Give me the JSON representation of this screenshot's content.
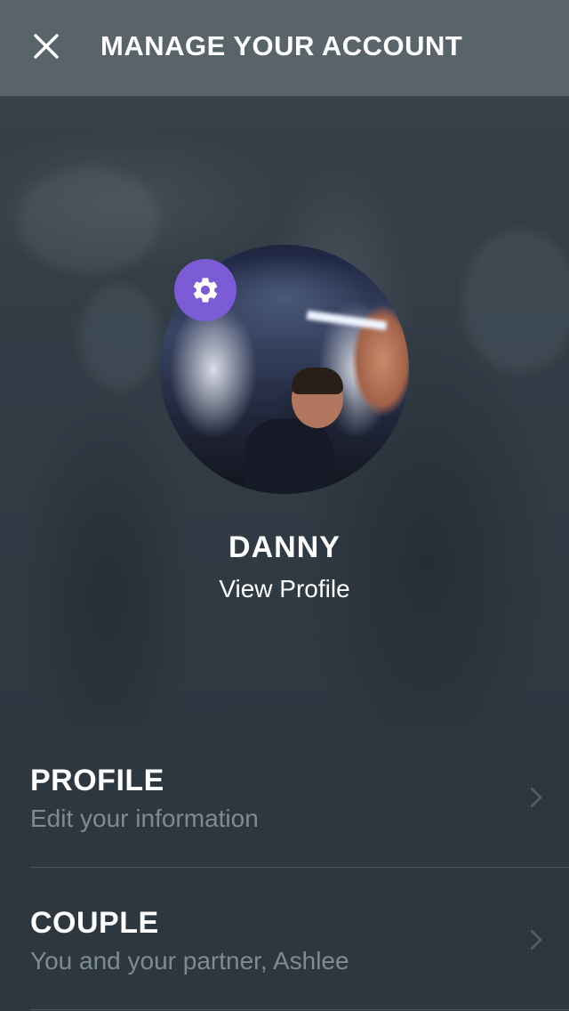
{
  "header": {
    "title": "MANAGE YOUR ACCOUNT",
    "close_icon": "close-icon"
  },
  "profile_card": {
    "name": "DANNY",
    "view_profile_label": "View Profile",
    "settings_icon": "gear-icon",
    "badge_color": "#7c5bd6"
  },
  "menu": {
    "items": [
      {
        "title": "PROFILE",
        "subtitle": "Edit your information",
        "icon": "chevron-right-icon"
      },
      {
        "title": "COUPLE",
        "subtitle": "You and your partner, Ashlee",
        "icon": "chevron-right-icon"
      }
    ]
  }
}
